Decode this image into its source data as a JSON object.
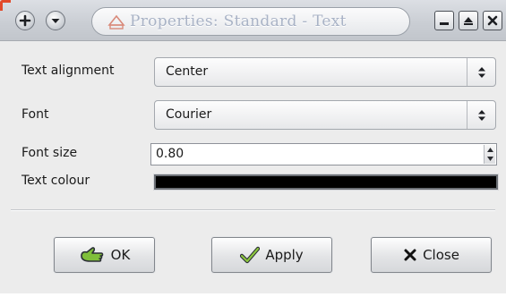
{
  "window": {
    "title": "Properties: Standard - Text",
    "icons": {
      "left_buttons": [
        "plus-circle-icon",
        "chevron-down-circle-icon"
      ],
      "app_icon": "shape-icon",
      "right_buttons": [
        "minimize-icon",
        "maximize-icon",
        "close-icon"
      ]
    }
  },
  "form": {
    "text_alignment": {
      "label": "Text alignment",
      "value": "Center"
    },
    "font": {
      "label": "Font",
      "value": "Courier"
    },
    "font_size": {
      "label": "Font size",
      "value": "0.80"
    },
    "text_colour": {
      "label": "Text colour",
      "value": "#000000"
    }
  },
  "buttons": {
    "ok": {
      "label": "OK",
      "icon": "hand-ok-icon"
    },
    "apply": {
      "label": "Apply",
      "icon": "checkmark-icon"
    },
    "close": {
      "label": "Close",
      "icon": "x-icon"
    }
  },
  "colors": {
    "accent_corner": "#e24a2a",
    "title_text": "#a9b3c6",
    "window_bg": "#ececec"
  }
}
